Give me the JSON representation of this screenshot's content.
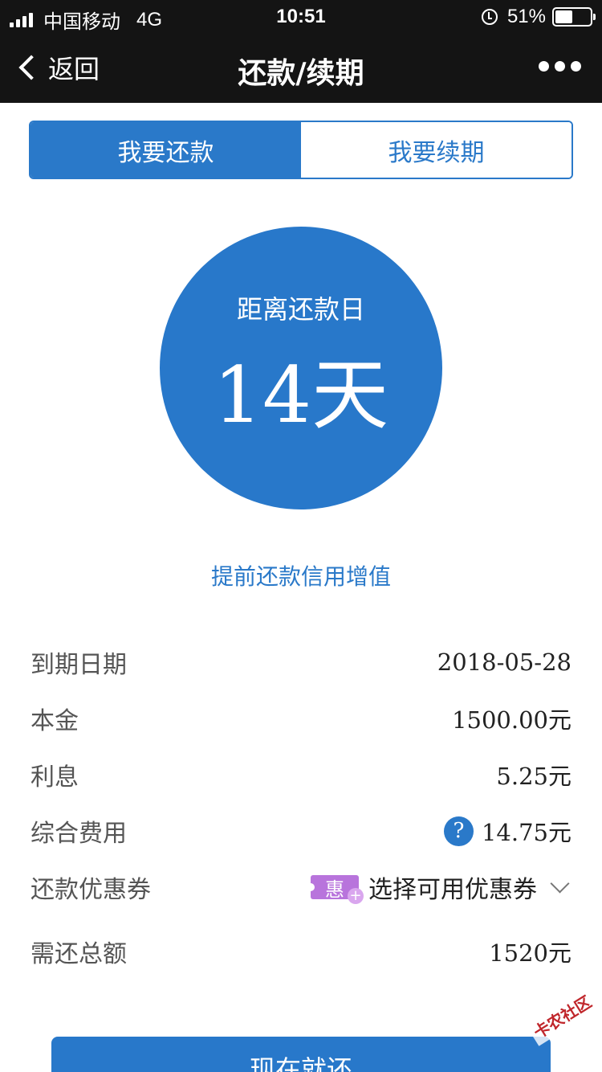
{
  "status_bar": {
    "carrier": "中国移动",
    "network": "4G",
    "time": "10:51",
    "battery": "51%",
    "battery_level": 0.51
  },
  "nav": {
    "back_label": "返回",
    "title": "还款/续期",
    "more_icon": "more-dots-icon"
  },
  "tabs": [
    {
      "label": "我要还款",
      "active": true
    },
    {
      "label": "我要续期",
      "active": false
    }
  ],
  "countdown": {
    "label": "距离还款日",
    "value": "14天"
  },
  "promo_link": "提前还款信用增值",
  "details": {
    "due_date": {
      "label": "到期日期",
      "value": "2018-05-28"
    },
    "principal": {
      "label": "本金",
      "value": "1500.00元"
    },
    "interest": {
      "label": "利息",
      "value": "5.25元"
    },
    "fees": {
      "label": "综合费用",
      "value": "14.75元",
      "help": "?"
    },
    "coupon": {
      "label": "还款优惠券",
      "badge": "惠",
      "badge_plus": "+",
      "value": "选择可用优惠券"
    },
    "total": {
      "label": "需还总额",
      "value": "1520元"
    }
  },
  "pay_button": "现在就还",
  "watermark": "卡农社区",
  "colors": {
    "primary": "#2a79c9",
    "bar_background": "#141414",
    "coupon_badge": "#b874dc"
  }
}
